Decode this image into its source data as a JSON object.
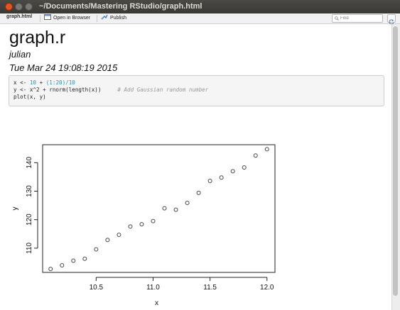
{
  "window": {
    "title": "~/Documents/Mastering RStudio/graph.html"
  },
  "toolbar": {
    "file_label": "graph.html",
    "open_browser_label": "Open in Browser",
    "publish_label": "Publish",
    "find_placeholder": "Find"
  },
  "document": {
    "title": "graph.r",
    "author": "julian",
    "date": "Tue Mar 24 19:08:19 2015"
  },
  "code": {
    "line1": {
      "a": "x <- ",
      "b": "10",
      "c": " + ",
      "d": "(1:20)/10"
    },
    "line2": {
      "a": "y <- x^2 + rnorm(length(x))",
      "comment": "# Add Gaussian random number"
    },
    "line3": {
      "a": "plot(x, y)"
    }
  },
  "chart_data": {
    "type": "scatter",
    "title": "",
    "xlabel": "x",
    "ylabel": "y",
    "xlim": [
      10.03,
      12.07
    ],
    "ylim": [
      101.5,
      146.3
    ],
    "xticks": [
      "10.5",
      "11.0",
      "11.5",
      "12.0"
    ],
    "xtick_values": [
      10.5,
      11.0,
      11.5,
      12.0
    ],
    "yticks": [
      "110",
      "120",
      "130",
      "140"
    ],
    "ytick_values": [
      110,
      120,
      130,
      140
    ],
    "series": [
      {
        "marker": "open-circle",
        "color": "#444444",
        "points": [
          [
            10.1,
            102.7
          ],
          [
            10.2,
            104.0
          ],
          [
            10.3,
            105.6
          ],
          [
            10.4,
            106.3
          ],
          [
            10.5,
            109.6
          ],
          [
            10.6,
            112.9
          ],
          [
            10.7,
            114.7
          ],
          [
            10.8,
            117.6
          ],
          [
            10.9,
            118.4
          ],
          [
            11.0,
            119.5
          ],
          [
            11.1,
            124.0
          ],
          [
            11.2,
            123.5
          ],
          [
            11.3,
            125.9
          ],
          [
            11.4,
            129.4
          ],
          [
            11.5,
            133.6
          ],
          [
            11.6,
            134.8
          ],
          [
            11.7,
            137.0
          ],
          [
            11.8,
            138.3
          ],
          [
            11.9,
            142.5
          ],
          [
            12.0,
            144.7
          ]
        ]
      }
    ]
  }
}
